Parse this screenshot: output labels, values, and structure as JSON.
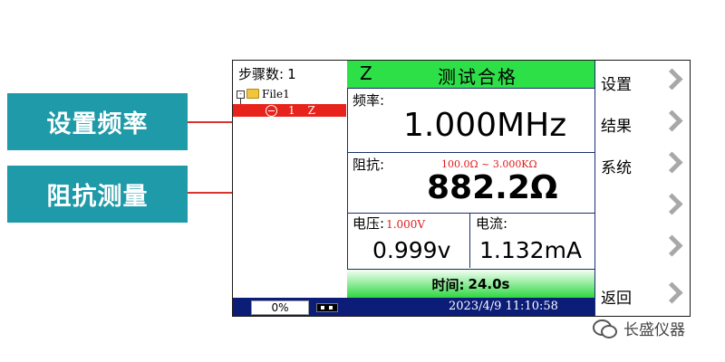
{
  "callouts": {
    "set_frequency": "设置频率",
    "impedance_measurement": "阻抗测量"
  },
  "tree": {
    "steps_label": "步骤数:",
    "steps_value": "1",
    "root_file": "File1",
    "selected_step_num": "1",
    "selected_step_mode": "Z"
  },
  "status": {
    "mode": "Z",
    "result": "测试合格",
    "color": "#2ee048"
  },
  "frequency": {
    "label": "频率:",
    "value": "1.000MHz"
  },
  "impedance": {
    "label": "阻抗:",
    "range": "100.0Ω ~ 3.000KΩ",
    "value": "882.2Ω"
  },
  "voltage": {
    "label": "电压:",
    "setpoint": "1.000V",
    "value": "0.999v"
  },
  "current": {
    "label": "电流:",
    "value": "1.132mA"
  },
  "time": {
    "label": "时间:",
    "value": "24.0s"
  },
  "menu": {
    "items": [
      {
        "label": "设置"
      },
      {
        "label": "结果"
      },
      {
        "label": "系统"
      },
      {
        "label": ""
      },
      {
        "label": ""
      },
      {
        "label": "返回"
      }
    ]
  },
  "footer": {
    "progress": "0%",
    "datetime": "2023/4/9 11:10:58"
  },
  "watermark": {
    "text": "长盛仪器"
  },
  "colors": {
    "callout_bg": "#1e9aa8",
    "leader_line": "#d9342b",
    "selection": "#e8231c",
    "footer_bg": "#0c1d78",
    "range_text": "#e01a1a"
  }
}
